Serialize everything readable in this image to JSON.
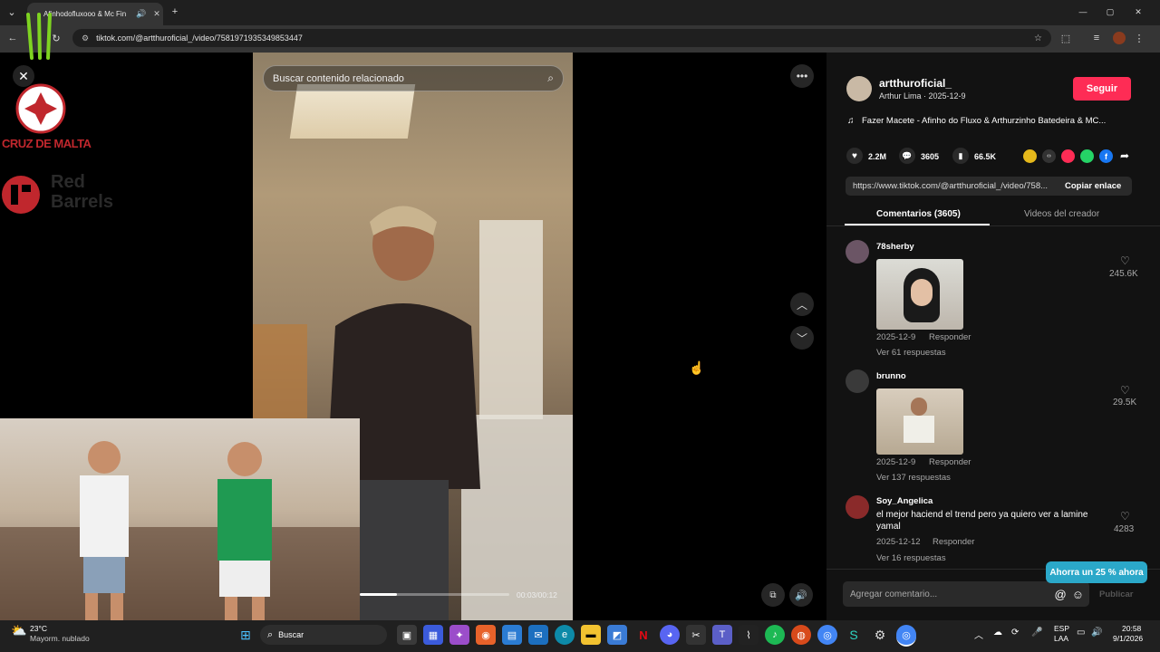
{
  "browser": {
    "tab_title": "Afinhodofluxooo & Mc Fin",
    "new_tab": "+",
    "url": "tiktok.com/@artthuroficial_/video/7581971935349853447",
    "window_min": "—",
    "window_max": "▢",
    "window_close": "✕"
  },
  "overlay": {
    "close": "✕",
    "brand1": "CRUZ DE MALTA",
    "brand2_line1": "Red",
    "brand2_line2": "Barrels"
  },
  "video": {
    "search_placeholder": "Buscar contenido relacionado",
    "time": "00:03/00:12",
    "progress": 0.25
  },
  "creator": {
    "handle": "artthuroficial_",
    "subtitle": "Arthur Lima · 2025-12-9",
    "follow": "Seguir",
    "music": "Fazer Macete - Afinho do Fluxo & Arthurzinho Batedeira & MC...",
    "likes": "2.2M",
    "comments": "3605",
    "saves": "66.5K",
    "link": "https://www.tiktok.com/@artthuroficial_/video/758...",
    "copy_link": "Copiar enlace"
  },
  "tabs": {
    "comments": "Comentarios (3605)",
    "creator_videos": "Videos del creador"
  },
  "comments": [
    {
      "user": "78sherby",
      "date": "2025-12-9",
      "reply": "Responder",
      "replies": "Ver 61 respuestas",
      "likes": "245.6K",
      "text": ""
    },
    {
      "user": "brunno",
      "date": "2025-12-9",
      "reply": "Responder",
      "replies": "Ver 137 respuestas",
      "likes": "29.5K",
      "text": ""
    },
    {
      "user": "Soy_Angelica",
      "date": "2025-12-12",
      "reply": "Responder",
      "replies": "Ver 16 respuestas",
      "likes": "4283",
      "text": "el mejor haciend el trend pero ya quiero ver a lamine yamal"
    }
  ],
  "composer": {
    "placeholder": "Agregar comentario...",
    "mention": "@",
    "emoji": "☺",
    "publish": "Publicar",
    "promo": "Ahorra un 25 % ahora"
  },
  "taskbar": {
    "temp": "23°C",
    "weather": "Mayorm. nublado",
    "search": "Buscar",
    "lang1": "ESP",
    "lang2": "LAA",
    "time": "20:58",
    "date": "9/1/2026"
  },
  "colors": {
    "accent": "#fe2c55",
    "panel": "#121212",
    "promo": "#2ba8c9"
  }
}
